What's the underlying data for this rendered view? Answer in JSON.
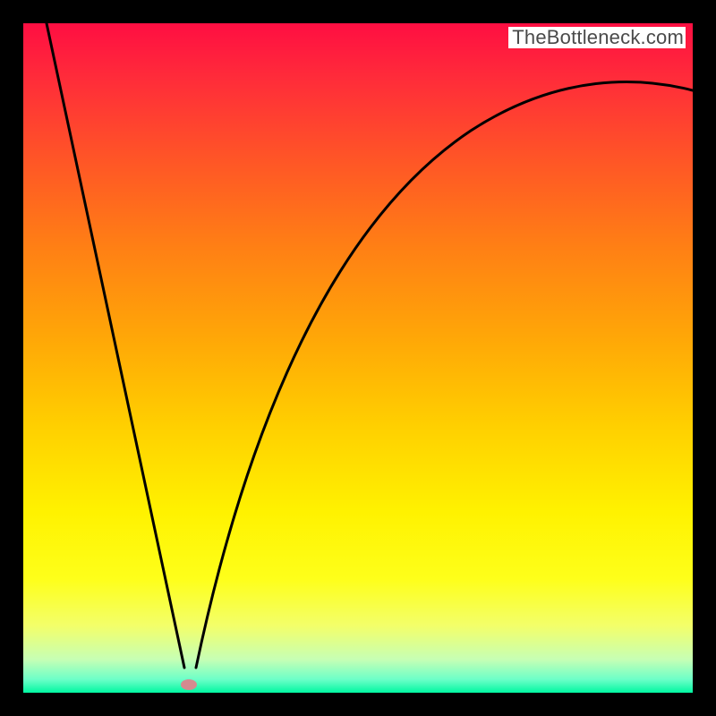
{
  "watermark": {
    "text": "TheBottleneck.com"
  },
  "chart_data": {
    "type": "line",
    "title": "",
    "xlabel": "",
    "ylabel": "",
    "xlim": [
      0,
      100
    ],
    "ylim": [
      0,
      100
    ],
    "series": [
      {
        "name": "bottleneck-curve",
        "x": [
          0,
          5,
          10,
          15,
          20,
          23.5,
          25,
          27,
          30,
          35,
          40,
          45,
          50,
          55,
          60,
          65,
          70,
          75,
          80,
          85,
          90,
          95,
          100
        ],
        "values": [
          100,
          79,
          58,
          37,
          16,
          1,
          0,
          6,
          18,
          34,
          46,
          55,
          62,
          68,
          73,
          77,
          80,
          83,
          85,
          87,
          88,
          89,
          90
        ]
      }
    ],
    "marker": {
      "x": 24.7,
      "y": 1.2
    },
    "background_gradient": {
      "top": "#ff0e42",
      "bottom": "#00f7a1"
    }
  }
}
